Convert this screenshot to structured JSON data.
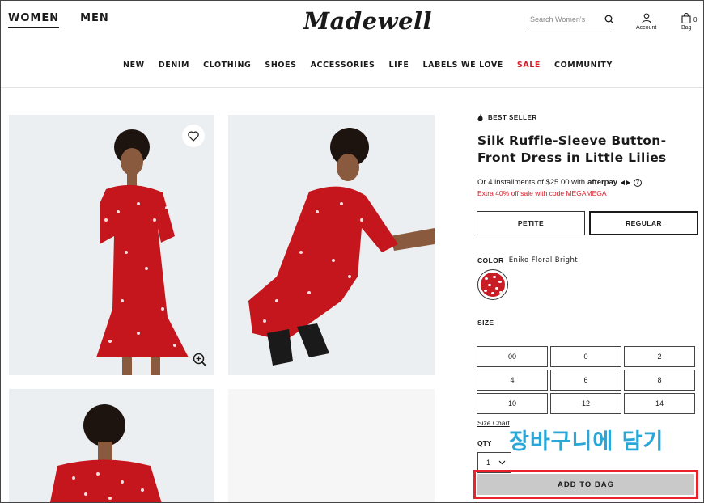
{
  "header": {
    "gender_tabs": [
      "WOMEN",
      "MEN"
    ],
    "logo": "Madewell",
    "search_placeholder": "Search Women's",
    "account_label": "Account",
    "bag_label": "Bag",
    "bag_count": "0"
  },
  "nav": {
    "items": [
      "NEW",
      "DENIM",
      "CLOTHING",
      "SHOES",
      "ACCESSORIES",
      "LIFE",
      "LABELS WE LOVE",
      "SALE",
      "COMMUNITY"
    ],
    "sale_color": "#d41f2a"
  },
  "product": {
    "badge": "BEST SELLER",
    "title": "Silk Ruffle-Sleeve Button-Front Dress in Little Lilies",
    "installments_text": "Or 4 installments of $25.00 with",
    "afterpay_label": "afterpay",
    "promo": "Extra 40% off sale with code MEGAMEGA",
    "fits": [
      "PETITE",
      "REGULAR"
    ],
    "selected_fit": "REGULAR",
    "color_key": "COLOR",
    "color_value": "Eniko Floral Bright",
    "swatch_color": "#c91d25",
    "size_label": "SIZE",
    "sizes": [
      "00",
      "0",
      "2",
      "4",
      "6",
      "8",
      "10",
      "12",
      "14"
    ],
    "size_chart": "Size Chart",
    "qty_label": "QTY",
    "qty_value": "1",
    "add_to_bag": "ADD TO BAG"
  },
  "annotation": {
    "caption": "장바구니에 담기",
    "caption_color": "#2aa7d6",
    "highlight_color": "#e8232c"
  }
}
